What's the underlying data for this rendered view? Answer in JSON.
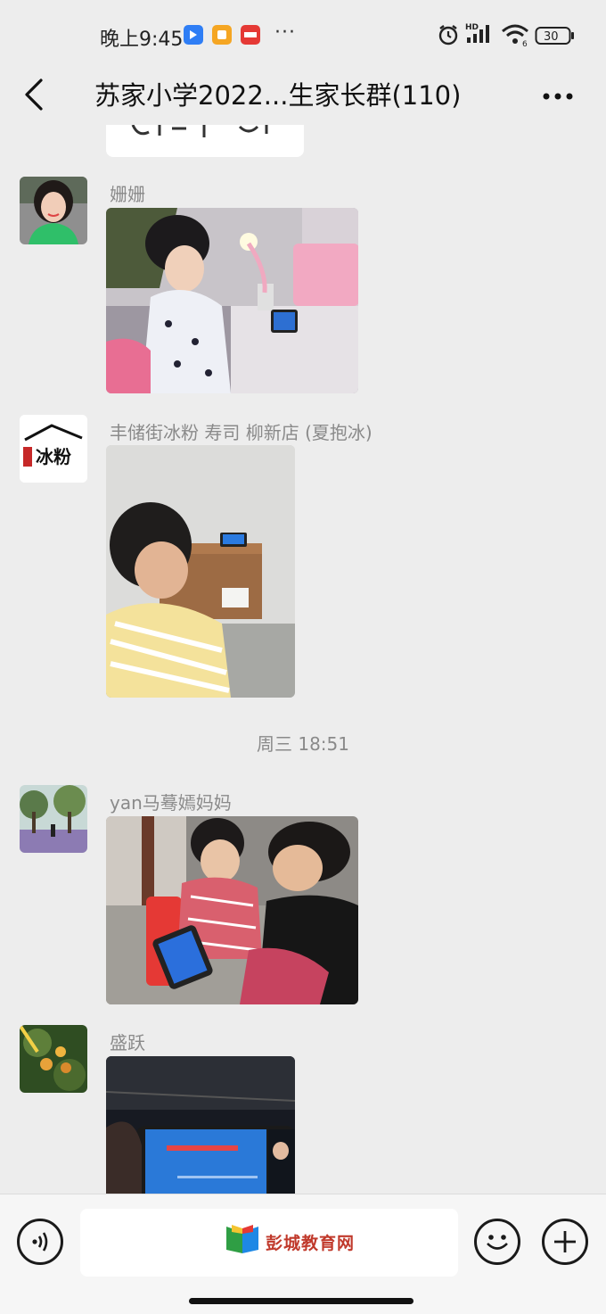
{
  "status_bar": {
    "time": "晚上9:45",
    "more": "···",
    "battery": "30",
    "signal_label": "HD",
    "wifi_label": "6"
  },
  "header": {
    "title": "苏家小学2022...生家长群(110)"
  },
  "chat": {
    "messages": [
      {
        "sender": "姗姗"
      },
      {
        "sender": "丰储街冰粉 寿司 柳新店 (夏抱冰)"
      },
      {
        "sender": "yan马蓦嫣妈妈"
      },
      {
        "sender": "盛跃"
      }
    ],
    "timestamp": "周三 18:51"
  },
  "input_bar": {
    "watermark": "彭城教育网"
  },
  "colors": {
    "background": "#ededed",
    "sender_gray": "#8a8a8a",
    "bar": "#f6f6f6"
  }
}
